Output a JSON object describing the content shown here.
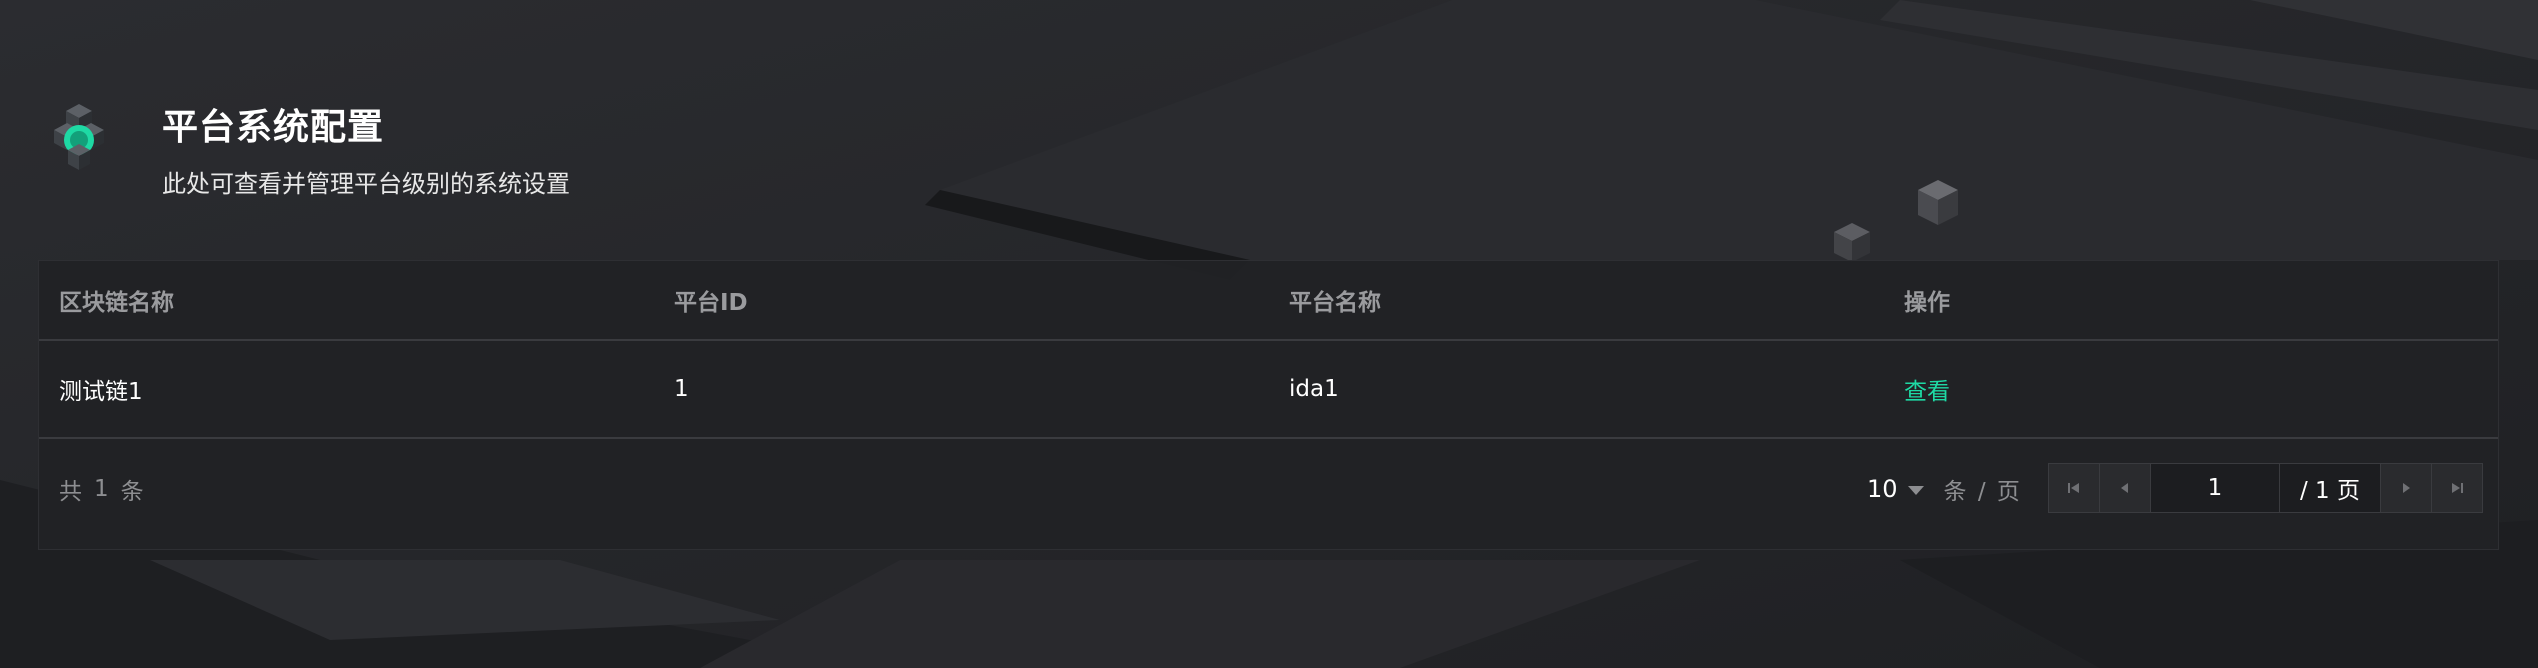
{
  "header": {
    "title": "平台系统配置",
    "subtitle": "此处可查看并管理平台级别的系统设置",
    "logo_icon": "cube-cluster-icon"
  },
  "table": {
    "columns": [
      "区块链名称",
      "平台ID",
      "平台名称",
      "操作"
    ],
    "rows": [
      {
        "chain_name": "测试链1",
        "platform_id": "1",
        "platform_name": "ida1",
        "action": "查看"
      }
    ]
  },
  "pagination": {
    "total_prefix": "共",
    "total_count": "1",
    "total_suffix": "条",
    "page_size": "10",
    "per_page_label": "条 / 页",
    "current_page": "1",
    "total_pages_label": "/ 1 页"
  },
  "colors": {
    "accent": "#1ed9a4",
    "background": "#232427",
    "panel": "#212225"
  }
}
